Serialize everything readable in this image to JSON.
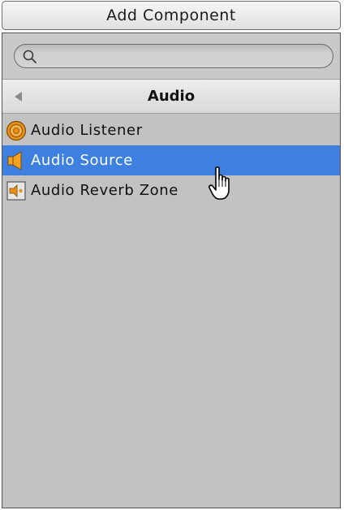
{
  "toolbar": {
    "add_component_label": "Add Component"
  },
  "search": {
    "value": "",
    "placeholder": ""
  },
  "header": {
    "title": "Audio"
  },
  "list": {
    "items": [
      {
        "label": "Audio Listener",
        "icon": "audio-listener-icon",
        "selected": false
      },
      {
        "label": "Audio Source",
        "icon": "audio-source-icon",
        "selected": true
      },
      {
        "label": "Audio Reverb Zone",
        "icon": "audio-reverb-zone-icon",
        "selected": false
      }
    ]
  },
  "colors": {
    "selection": "#3d80df",
    "panel_background": "#c2c2c2",
    "icon_orange": "#e8901a"
  }
}
